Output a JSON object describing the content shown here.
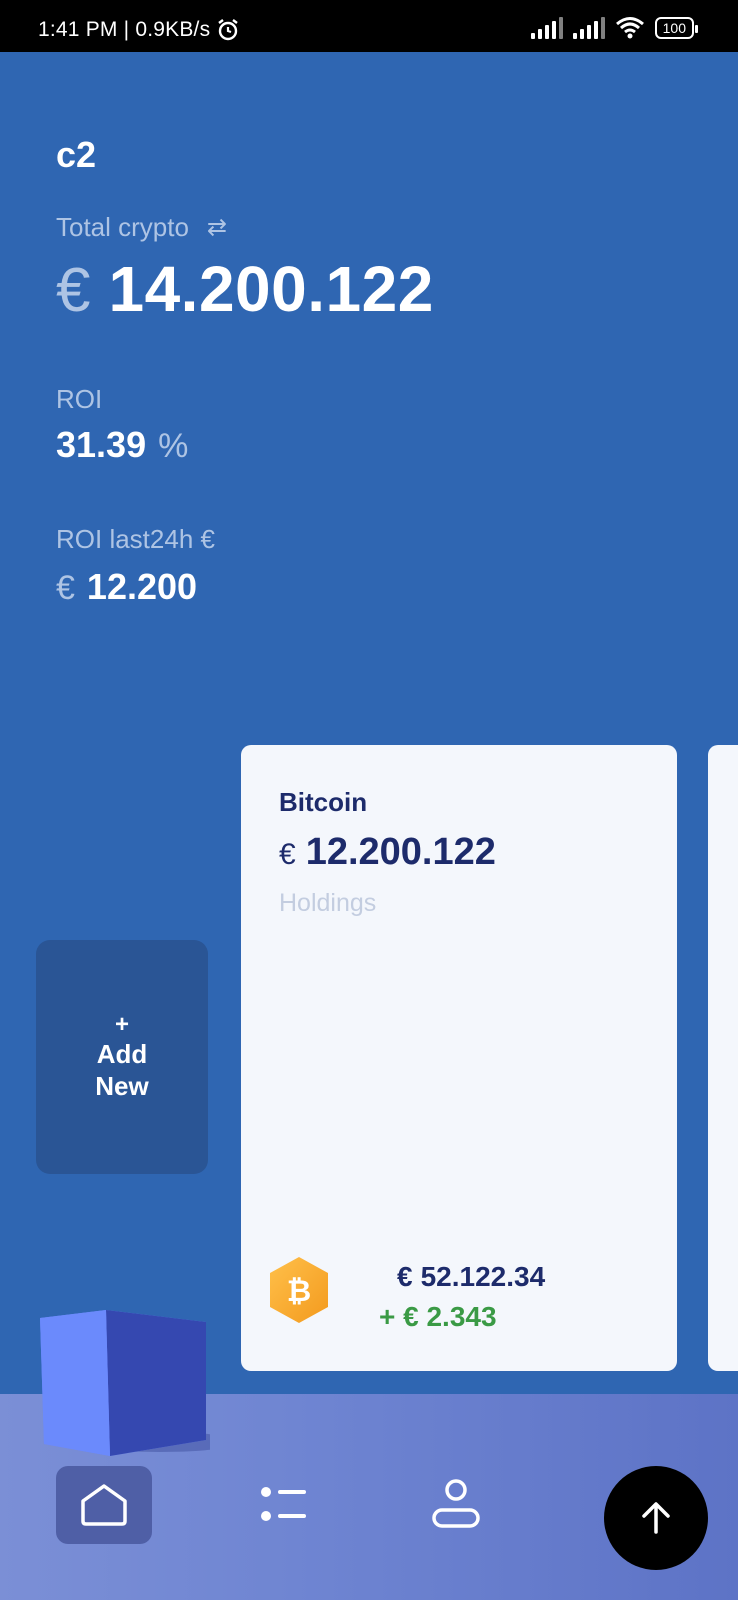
{
  "status_bar": {
    "time_speed": "1:41 PM | 0.9KB/s",
    "alarm_icon": "alarm-icon",
    "battery": "100"
  },
  "header": {
    "app_name": "c2",
    "total_label": "Total crypto",
    "swap_icon": "swap-arrows-icon",
    "currency_symbol": "€",
    "total_value": "14.200.122",
    "roi_label": "ROI",
    "roi_value": "31.39",
    "roi_unit": "%",
    "roi24_label": "ROI last24h €",
    "roi24_currency": "€",
    "roi24_value": "12.200"
  },
  "add_new": {
    "plus": "+",
    "line1": "Add",
    "line2": "New"
  },
  "coin_card": {
    "name": "Bitcoin",
    "currency": "€",
    "holdings_value": "12.200.122",
    "holdings_label": "Holdings",
    "icon": "bitcoin-icon",
    "price_currency": "€",
    "price": "52.122.34",
    "change": "+ € 2.343",
    "change_color": "#3a9a45"
  },
  "nav": {
    "home_icon": "home-icon",
    "list_icon": "list-icon",
    "profile_icon": "profile-icon",
    "fab_icon": "arrow-up-icon"
  },
  "colors": {
    "background": "#2f66b2",
    "card": "#f4f7fc",
    "text_dark": "#1d2b6b",
    "muted": "#aec4e4"
  }
}
